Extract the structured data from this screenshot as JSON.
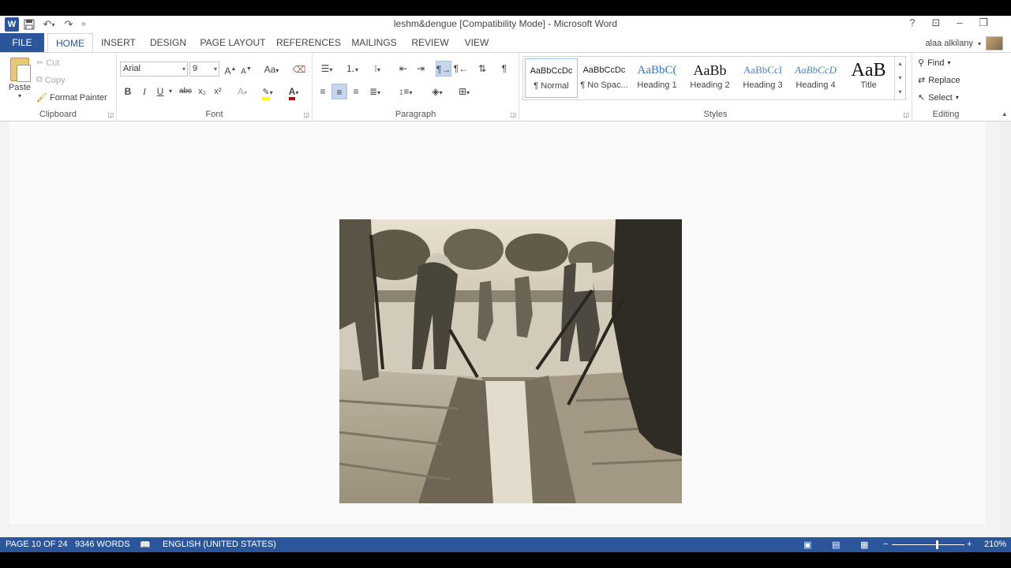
{
  "title_bar": {
    "document_title": "leshm&dengue [Compatibility Mode] - Microsoft Word",
    "help": "?",
    "qat_customize": "="
  },
  "tabs": [
    "FILE",
    "HOME",
    "INSERT",
    "DESIGN",
    "PAGE LAYOUT",
    "REFERENCES",
    "MAILINGS",
    "REVIEW",
    "VIEW"
  ],
  "active_tab": "HOME",
  "user": {
    "name": "alaa alkilany"
  },
  "clipboard": {
    "paste": "Paste",
    "cut": "Cut",
    "copy": "Copy",
    "format_painter": "Format Painter",
    "label": "Clipboard"
  },
  "font": {
    "family": "Arial",
    "size": "9",
    "grow": "A",
    "shrink": "A",
    "change_case": "Aa",
    "bold": "B",
    "italic": "I",
    "underline": "U",
    "strikethrough": "abc",
    "subscript": "x₂",
    "superscript": "x²",
    "label": "Font"
  },
  "paragraph": {
    "label": "Paragraph",
    "pilcrow": "¶"
  },
  "styles": {
    "label": "Styles",
    "items": [
      {
        "sample": "AaBbCcDc",
        "name": "¶ Normal"
      },
      {
        "sample": "AaBbCcDc",
        "name": "¶ No Spac..."
      },
      {
        "sample": "AaBbC(",
        "name": "Heading 1"
      },
      {
        "sample": "AaBb",
        "name": "Heading 2"
      },
      {
        "sample": "AaBbCcI",
        "name": "Heading 3"
      },
      {
        "sample": "AaBbCcD",
        "name": "Heading 4"
      },
      {
        "sample": "AaB",
        "name": "Title"
      }
    ]
  },
  "editing": {
    "find": "Find",
    "replace": "Replace",
    "select": "Select",
    "label": "Editing"
  },
  "status_bar": {
    "page": "PAGE 10 OF 24",
    "words": "9346 WORDS",
    "language": "ENGLISH (UNITED STATES)",
    "zoom": "210%"
  },
  "colors": {
    "accent": "#2b579a",
    "highlight": "#ffff00",
    "font_color": "#c00000"
  }
}
